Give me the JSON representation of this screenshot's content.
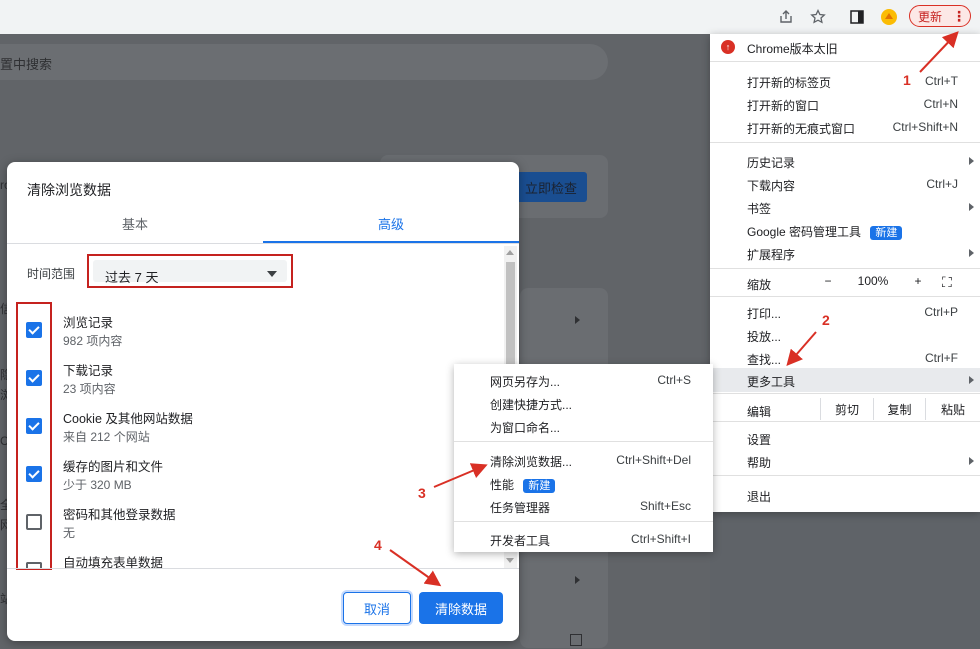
{
  "toolbar": {
    "icons": [
      "share-icon",
      "star-icon",
      "sidebar-icon",
      "extension-icon"
    ],
    "update_label": "更新",
    "menu_dots": "⋮"
  },
  "background_page": {
    "search_placeholder": "置中搜索",
    "check_now_label": "立即检查",
    "left_fragments": [
      "ro",
      "信",
      "隐",
      "浏",
      "C",
      "全",
      "网",
      "站"
    ]
  },
  "dialog": {
    "title": "清除浏览数据",
    "tabs": [
      {
        "label": "基本"
      },
      {
        "label": "高级"
      }
    ],
    "active_tab": "高级",
    "time_range_label": "时间范围",
    "time_range_value": "过去 7 天",
    "items": [
      {
        "title": "浏览记录",
        "subtitle": "982 项内容",
        "checked": true
      },
      {
        "title": "下载记录",
        "subtitle": "23 项内容",
        "checked": true
      },
      {
        "title": "Cookie 及其他网站数据",
        "subtitle": "来自 212 个网站",
        "checked": true
      },
      {
        "title": "缓存的图片和文件",
        "subtitle": "少于 320 MB",
        "checked": true
      },
      {
        "title": "密码和其他登录数据",
        "subtitle": "无",
        "checked": false
      },
      {
        "title": "自动填充表单数据",
        "subtitle": "",
        "checked": false
      }
    ],
    "cancel_label": "取消",
    "clear_label": "清除数据"
  },
  "menu": {
    "update_notice": "Chrome版本太旧",
    "new_tab": {
      "label": "打开新的标签页",
      "shortcut": "Ctrl+T"
    },
    "new_window": {
      "label": "打开新的窗口",
      "shortcut": "Ctrl+N"
    },
    "incognito": {
      "label": "打开新的无痕式窗口",
      "shortcut": "Ctrl+Shift+N"
    },
    "history": {
      "label": "历史记录"
    },
    "downloads": {
      "label": "下载内容",
      "shortcut": "Ctrl+J"
    },
    "bookmarks": {
      "label": "书签"
    },
    "password_manager": {
      "label": "Google 密码管理工具",
      "badge": "新建"
    },
    "extensions": {
      "label": "扩展程序"
    },
    "zoom": {
      "label": "缩放",
      "minus": "−",
      "value": "100%",
      "plus": "+",
      "fullscreen": "⛶"
    },
    "print": {
      "label": "打印...",
      "shortcut": "Ctrl+P"
    },
    "cast": {
      "label": "投放..."
    },
    "find": {
      "label": "查找...",
      "shortcut": "Ctrl+F"
    },
    "more_tools": {
      "label": "更多工具"
    },
    "edit": {
      "label": "编辑",
      "cut": "剪切",
      "copy": "复制",
      "paste": "粘贴"
    },
    "settings": {
      "label": "设置"
    },
    "help": {
      "label": "帮助"
    },
    "exit": {
      "label": "退出"
    }
  },
  "submenu": {
    "save_page": {
      "label": "网页另存为...",
      "shortcut": "Ctrl+S"
    },
    "create_shortcut": {
      "label": "创建快捷方式..."
    },
    "name_window": {
      "label": "为窗口命名..."
    },
    "clear_data": {
      "label": "清除浏览数据...",
      "shortcut": "Ctrl+Shift+Del"
    },
    "performance": {
      "label": "性能",
      "badge": "新建"
    },
    "task_manager": {
      "label": "任务管理器",
      "shortcut": "Shift+Esc"
    },
    "devtools": {
      "label": "开发者工具",
      "shortcut": "Ctrl+Shift+I"
    }
  },
  "annotations": {
    "step1": "1",
    "step2": "2",
    "step3": "3",
    "step4": "4"
  },
  "colors": {
    "accent": "#1a73e8",
    "annotation": "#d93025"
  }
}
